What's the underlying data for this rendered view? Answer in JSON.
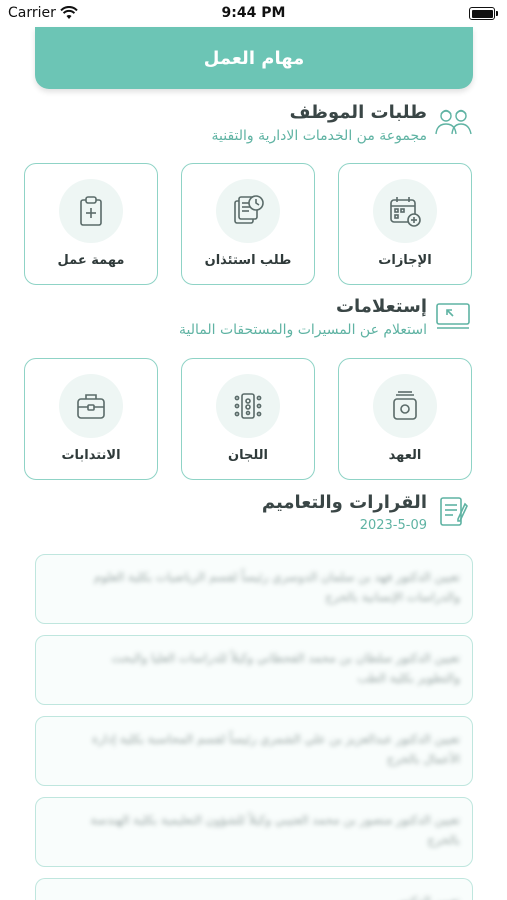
{
  "status_bar": {
    "carrier": "Carrier",
    "time": "9:44 PM"
  },
  "header": {
    "title": "مهام العمل"
  },
  "employee_requests": {
    "title": "طلبات الموظف",
    "subtitle": "مجموعة من الخدمات الادارية والتقنية",
    "items": [
      {
        "label": "الإجازات",
        "icon": "calendar-icon"
      },
      {
        "label": "طلب استئذان",
        "icon": "documents-clock-icon"
      },
      {
        "label": "مهمة عمل",
        "icon": "clipboard-add-icon"
      }
    ]
  },
  "inquiries": {
    "title": "إستعلامات",
    "subtitle": "استعلام عن المسيرات والمستحقات المالية",
    "items": [
      {
        "label": "العهد",
        "icon": "box-icon"
      },
      {
        "label": "اللجان",
        "icon": "committee-icon"
      },
      {
        "label": "الانتدابات",
        "icon": "briefcase-icon"
      }
    ]
  },
  "decisions": {
    "title": "القرارات والتعاميم",
    "date": "2023-5-09",
    "items": [
      "تعيين الدكتور فهد بن سلمان الدوسري رئيساً لقسم الرياضيات بكلية العلوم والدراسات الإنسانية بالخرج",
      "تعيين الدكتور سلطان بن محمد القحطاني وكيلاً للدراسات العليا والبحث والتطوير بكلية الطب",
      "تعيين الدكتور عبدالعزيز بن علي الشمري رئيساً لقسم المحاسبة بكلية إدارة الأعمال بالخرج",
      "تعيين الدكتور منصور بن محمد العتيبي وكيلاً للشؤون التعليمية بكلية الهندسة بالخرج",
      "تعيين الدكتور"
    ]
  }
}
